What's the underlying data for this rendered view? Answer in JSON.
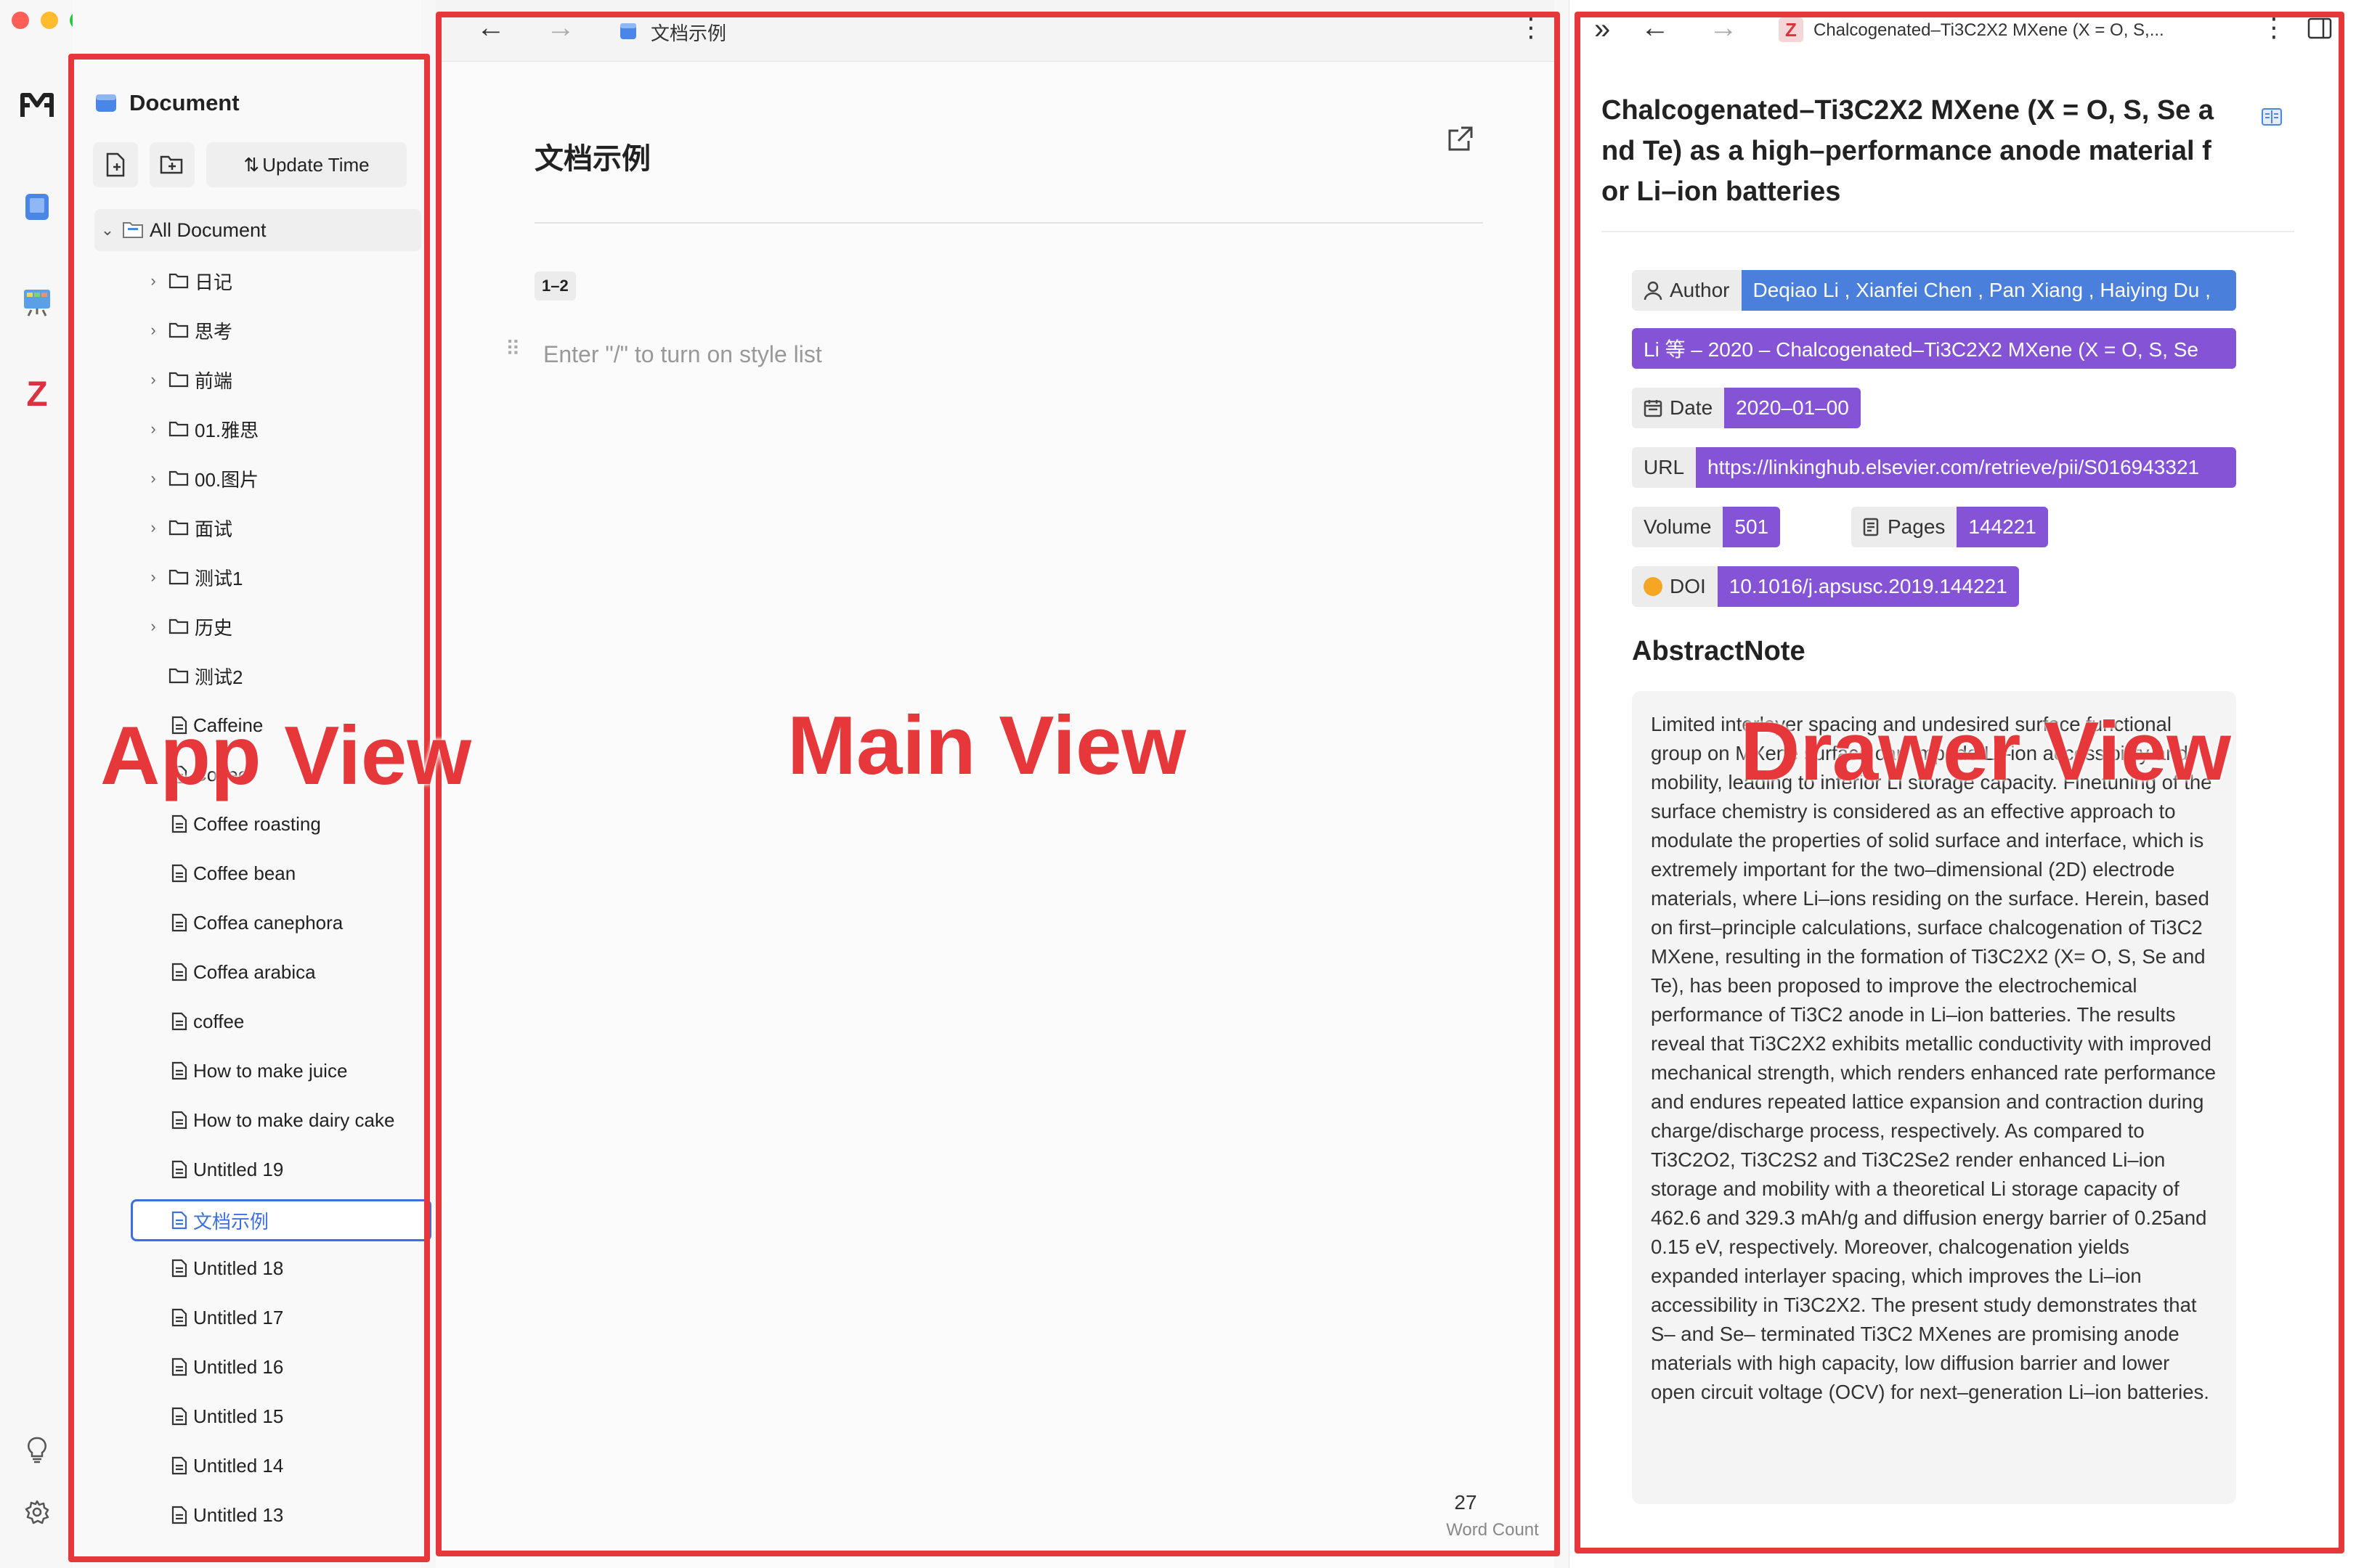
{
  "window": {
    "dots": [
      "#ff5f57",
      "#febc2e",
      "#28c840"
    ]
  },
  "rail": {
    "logo_text": "M",
    "zotero_letter": "Z"
  },
  "sidebar": {
    "title": "Document",
    "sort_label": "Update Time",
    "root_label": "All Document",
    "items": [
      {
        "label": "日记",
        "type": "folder",
        "expandable": true
      },
      {
        "label": "思考",
        "type": "folder",
        "expandable": true
      },
      {
        "label": "前端",
        "type": "folder",
        "expandable": true
      },
      {
        "label": "01.雅思",
        "type": "folder",
        "expandable": true
      },
      {
        "label": "00.图片",
        "type": "folder",
        "expandable": true
      },
      {
        "label": "面试",
        "type": "folder",
        "expandable": true
      },
      {
        "label": "测试1",
        "type": "folder",
        "expandable": true
      },
      {
        "label": "历史",
        "type": "folder",
        "expandable": true
      },
      {
        "label": "测试2",
        "type": "folder",
        "expandable": false
      },
      {
        "label": "Caffeine",
        "type": "doc"
      },
      {
        "label": "Coffee",
        "type": "doc"
      },
      {
        "label": "Coffee roasting",
        "type": "doc"
      },
      {
        "label": "Coffee bean",
        "type": "doc"
      },
      {
        "label": "Coffea canephora",
        "type": "doc"
      },
      {
        "label": "Coffea arabica",
        "type": "doc"
      },
      {
        "label": "coffee",
        "type": "doc"
      },
      {
        "label": "How to make juice",
        "type": "doc"
      },
      {
        "label": "How to make dairy cake",
        "type": "doc"
      },
      {
        "label": "Untitled 19",
        "type": "doc"
      },
      {
        "label": "文档示例",
        "type": "doc",
        "selected": true
      },
      {
        "label": "Untitled 18",
        "type": "doc"
      },
      {
        "label": "Untitled 17",
        "type": "doc"
      },
      {
        "label": "Untitled 16",
        "type": "doc"
      },
      {
        "label": "Untitled 15",
        "type": "doc"
      },
      {
        "label": "Untitled 14",
        "type": "doc"
      },
      {
        "label": "Untitled 13",
        "type": "doc"
      }
    ]
  },
  "main": {
    "tab_title": "文档示例",
    "doc_title": "文档示例",
    "tag": "1–2",
    "placeholder": "Enter \"/\" to turn on style list",
    "word_count_value": "27",
    "word_count_label": "Word Count"
  },
  "drawer": {
    "tab_title": "Chalcogenated–Ti3C2X2 MXene (X = O, S,...",
    "title": "Chalcogenated–Ti3C2X2 MXene (X = O, S, Se and Te) as a high–performance anode material for Li–ion batteries",
    "author_key": "Author",
    "author_val": "Deqiao Li , Xianfei Chen , Pan Xiang , Haiying Du ,",
    "citation_val": "Li 等 – 2020 – Chalcogenated–Ti3C2X2 MXene (X = O, S, Se",
    "date_key": "Date",
    "date_val": "2020–01–00",
    "url_key": "URL",
    "url_val": "https://linkinghub.elsevier.com/retrieve/pii/S016943321",
    "volume_key": "Volume",
    "volume_val": "501",
    "pages_key": "Pages",
    "pages_val": "144221",
    "doi_key": "DOI",
    "doi_val": "10.1016/j.apsusc.2019.144221",
    "abstract_heading": "AbstractNote",
    "abstract": "Limited interlayer spacing and undesired surface functional group on MXene surface can impede Li–ion accessibility and mobility, leading to inferior Li storage capacity. Finetuning of the surface chemistry is considered as an effective approach to modulate the properties of solid surface and interface, which is extremely important for the two–dimensional (2D) electrode materials, where Li–ions residing on the surface. Herein, based on first–principle calculations, surface chalcogenation of Ti3C2 MXene, resulting in the formation of Ti3C2X2 (X= O, S, Se and Te), has been proposed to improve the electrochemical performance of Ti3C2 anode in Li–ion batteries. The results reveal that Ti3C2X2 exhibits metallic conductivity with improved mechanical strength, which renders enhanced rate performance and endures repeated lattice expansion and contraction during charge/discharge process, respectively. As compared to Ti3C2O2, Ti3C2S2 and Ti3C2Se2 render enhanced Li–ion storage and mobility with a theoretical Li storage capacity of 462.6 and 329.3 mAh/g and diffusion energy barrier of 0.25and 0.15 eV, respectively. Moreover, chalcogenation yields expanded interlayer spacing, which improves the Li–ion accessibility in Ti3C2X2. The present study demonstrates that S– and Se– terminated Ti3C2 MXenes are promising anode materials with high capacity, low diffusion barrier and lower open circuit voltage (OCV) for next–generation Li–ion batteries."
  },
  "annotations": {
    "app_view": "App View",
    "main_view": "Main View",
    "drawer_view": "Drawer View",
    "frame_color": "#e6383b"
  },
  "colors": {
    "author_blue": "#4a7fdc",
    "purple": "#8553d6",
    "selected_border": "#3d6fe0"
  }
}
